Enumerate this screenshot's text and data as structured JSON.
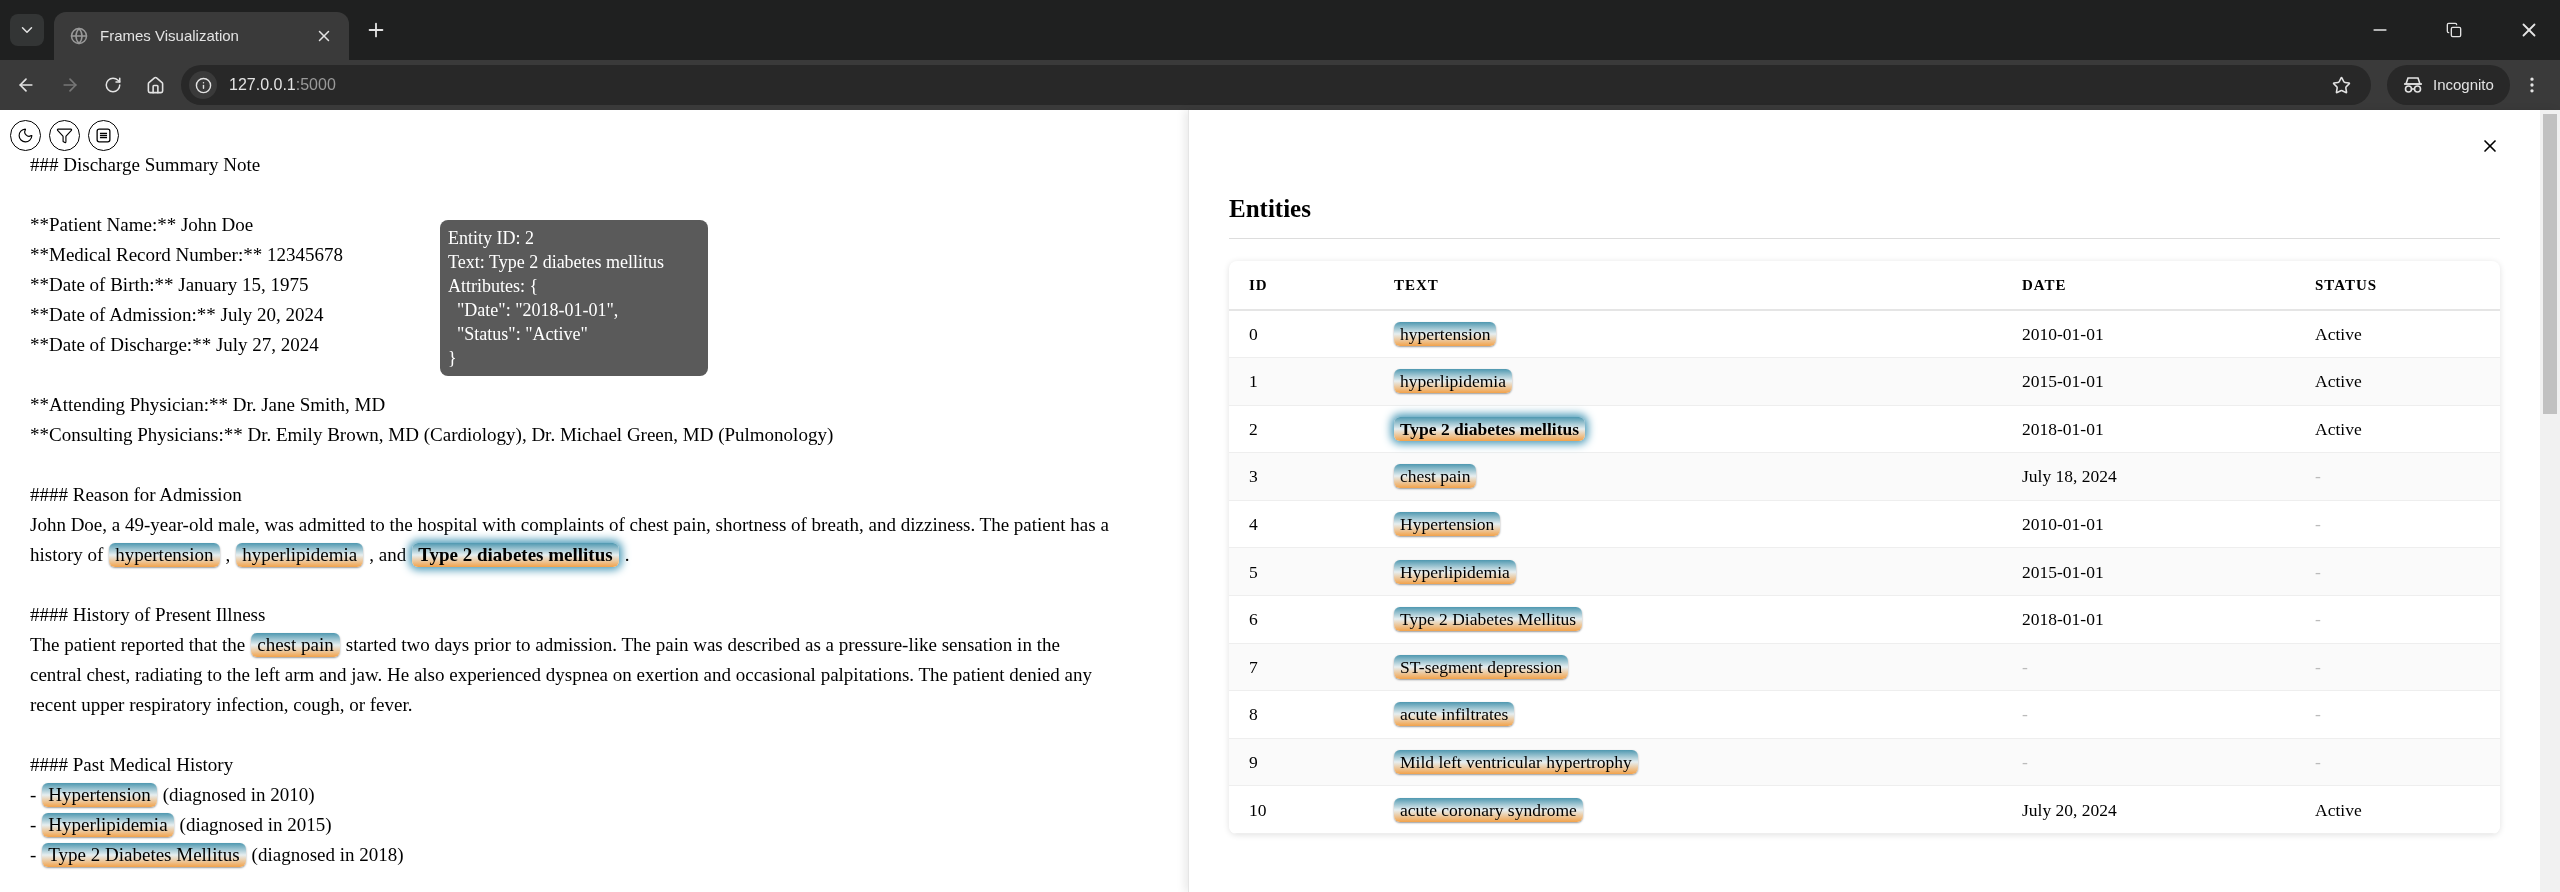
{
  "browser": {
    "tab_title": "Frames Visualization",
    "url_host": "127.0.0.1",
    "url_port": ":5000",
    "profile": "Incognito",
    "forward_disabled": true
  },
  "document": {
    "sections": [
      {
        "lines": [
          [
            {
              "kind": "text",
              "text": "### Discharge Summary Note"
            }
          ]
        ]
      },
      {
        "lines": [
          [
            {
              "kind": "text",
              "text": "**Patient Name:** John Doe"
            }
          ],
          [
            {
              "kind": "text",
              "text": "**Medical Record Number:** 12345678"
            }
          ],
          [
            {
              "kind": "text",
              "text": "**Date of Birth:** January 15, 1975"
            }
          ],
          [
            {
              "kind": "text",
              "text": "**Date of Admission:** July 20, 2024"
            }
          ],
          [
            {
              "kind": "text",
              "text": "**Date of Discharge:** July 27, 2024"
            }
          ]
        ]
      },
      {
        "lines": [
          [
            {
              "kind": "text",
              "text": "**Attending Physician:** Dr. Jane Smith, MD"
            }
          ],
          [
            {
              "kind": "text",
              "text": "**Consulting Physicians:** Dr. Emily Brown, MD (Cardiology), Dr. Michael Green, MD (Pulmonology)"
            }
          ]
        ]
      },
      {
        "lines": [
          [
            {
              "kind": "text",
              "text": "#### Reason for Admission"
            }
          ],
          [
            {
              "kind": "text",
              "text": "John Doe, a 49-year-old male, was admitted to the hospital with complaints of chest pain, shortness of breath, and dizziness. The patient has a"
            }
          ],
          [
            {
              "kind": "text",
              "text": "history of"
            },
            {
              "kind": "entity",
              "text": "hypertension",
              "highlighted": false
            },
            {
              "kind": "text",
              "text": ","
            },
            {
              "kind": "entity",
              "text": "hyperlipidemia",
              "highlighted": false
            },
            {
              "kind": "text",
              "text": ", and"
            },
            {
              "kind": "entity",
              "text": "Type 2 diabetes mellitus",
              "highlighted": true
            },
            {
              "kind": "text",
              "text": "."
            }
          ]
        ]
      },
      {
        "lines": [
          [
            {
              "kind": "text",
              "text": "#### History of Present Illness"
            }
          ],
          [
            {
              "kind": "text",
              "text": "The patient reported that the"
            },
            {
              "kind": "entity",
              "text": "chest pain",
              "highlighted": false
            },
            {
              "kind": "text",
              "text": "started two days prior to admission. The pain was described as a pressure-like sensation in the"
            }
          ],
          [
            {
              "kind": "text",
              "text": "central chest, radiating to the left arm and jaw. He also experienced dyspnea on exertion and occasional palpitations. The patient denied any"
            }
          ],
          [
            {
              "kind": "text",
              "text": "recent upper respiratory infection, cough, or fever."
            }
          ]
        ]
      },
      {
        "lines": [
          [
            {
              "kind": "text",
              "text": "#### Past Medical History"
            }
          ],
          [
            {
              "kind": "text",
              "text": "-"
            },
            {
              "kind": "entity",
              "text": "Hypertension",
              "highlighted": false
            },
            {
              "kind": "text",
              "text": "(diagnosed in 2010)"
            }
          ],
          [
            {
              "kind": "text",
              "text": "-"
            },
            {
              "kind": "entity",
              "text": "Hyperlipidemia",
              "highlighted": false
            },
            {
              "kind": "text",
              "text": "(diagnosed in 2015)"
            }
          ],
          [
            {
              "kind": "text",
              "text": "-"
            },
            {
              "kind": "entity",
              "text": "Type 2 Diabetes Mellitus",
              "highlighted": false
            },
            {
              "kind": "text",
              "text": "(diagnosed in 2018)"
            }
          ]
        ]
      }
    ]
  },
  "tooltip": {
    "lines": [
      "Entity ID: 2",
      "Text: Type 2 diabetes mellitus",
      "Attributes: {",
      "  \"Date\": \"2018-01-01\",",
      "  \"Status\": \"Active\"",
      "}"
    ]
  },
  "entities": {
    "title": "Entities",
    "columns": [
      "ID",
      "TEXT",
      "DATE",
      "STATUS"
    ],
    "rows": [
      {
        "id": "0",
        "text": "hypertension",
        "highlighted": false,
        "date": {
          "value": "2010-01-01",
          "muted": false
        },
        "status": {
          "value": "Active",
          "muted": false
        }
      },
      {
        "id": "1",
        "text": "hyperlipidemia",
        "highlighted": false,
        "date": {
          "value": "2015-01-01",
          "muted": false
        },
        "status": {
          "value": "Active",
          "muted": false
        }
      },
      {
        "id": "2",
        "text": "Type 2 diabetes mellitus",
        "highlighted": true,
        "date": {
          "value": "2018-01-01",
          "muted": false
        },
        "status": {
          "value": "Active",
          "muted": false
        }
      },
      {
        "id": "3",
        "text": "chest pain",
        "highlighted": false,
        "date": {
          "value": "July 18, 2024",
          "muted": false
        },
        "status": {
          "value": "-",
          "muted": true
        }
      },
      {
        "id": "4",
        "text": "Hypertension",
        "highlighted": false,
        "date": {
          "value": "2010-01-01",
          "muted": false
        },
        "status": {
          "value": "-",
          "muted": true
        }
      },
      {
        "id": "5",
        "text": "Hyperlipidemia",
        "highlighted": false,
        "date": {
          "value": "2015-01-01",
          "muted": false
        },
        "status": {
          "value": "-",
          "muted": true
        }
      },
      {
        "id": "6",
        "text": "Type 2 Diabetes Mellitus",
        "highlighted": false,
        "date": {
          "value": "2018-01-01",
          "muted": false
        },
        "status": {
          "value": "-",
          "muted": true
        }
      },
      {
        "id": "7",
        "text": "ST-segment depression",
        "highlighted": false,
        "date": {
          "value": "-",
          "muted": true
        },
        "status": {
          "value": "-",
          "muted": true
        }
      },
      {
        "id": "8",
        "text": "acute infiltrates",
        "highlighted": false,
        "date": {
          "value": "-",
          "muted": true
        },
        "status": {
          "value": "-",
          "muted": true
        }
      },
      {
        "id": "9",
        "text": "Mild left ventricular hypertrophy",
        "highlighted": false,
        "date": {
          "value": "-",
          "muted": true
        },
        "status": {
          "value": "-",
          "muted": true
        }
      },
      {
        "id": "10",
        "text": "acute coronary syndrome",
        "highlighted": false,
        "date": {
          "value": "July 20, 2024",
          "muted": false
        },
        "status": {
          "value": "Active",
          "muted": false
        }
      }
    ]
  }
}
